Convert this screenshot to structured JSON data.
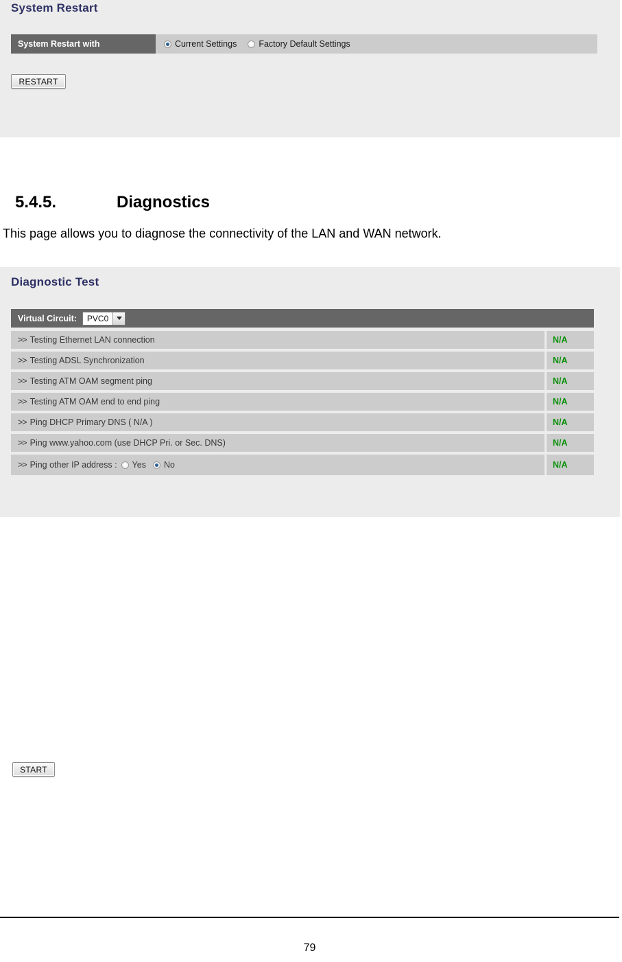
{
  "restart_panel": {
    "title": "System Restart",
    "label": "System Restart with",
    "options": [
      {
        "label": "Current Settings",
        "checked": true
      },
      {
        "label": "Factory Default Settings",
        "checked": false
      }
    ],
    "button_label": "RESTART"
  },
  "section": {
    "number": "5.4.5.",
    "heading": "Diagnostics",
    "intro": "This page allows you to diagnose the connectivity of the LAN and WAN network."
  },
  "diagnostic_panel": {
    "title": "Diagnostic Test",
    "virtual_circuit_label": "Virtual Circuit:",
    "virtual_circuit_value": "PVC0",
    "dropdown_icon": "chevron-down-icon",
    "rows": [
      {
        "prefix": ">>",
        "name": "Testing Ethernet LAN connection",
        "status": "N/A"
      },
      {
        "prefix": ">>",
        "name": "Testing ADSL Synchronization",
        "status": "N/A"
      },
      {
        "prefix": ">>",
        "name": "Testing ATM OAM segment ping",
        "status": "N/A"
      },
      {
        "prefix": ">>",
        "name": "Testing ATM OAM end to end ping",
        "status": "N/A"
      },
      {
        "prefix": ">>",
        "name": "Ping DHCP Primary DNS ( N/A )",
        "status": "N/A"
      },
      {
        "prefix": ">>",
        "name": "Ping www.yahoo.com (use DHCP Pri. or Sec. DNS)",
        "status": "N/A"
      },
      {
        "prefix": ">>",
        "name": "Ping other IP address :",
        "status": "N/A",
        "options": [
          {
            "label": "Yes",
            "checked": false
          },
          {
            "label": "No",
            "checked": true
          }
        ]
      }
    ],
    "button_label": "START"
  },
  "footer": {
    "page_number": "79"
  },
  "colors": {
    "panel_background": "#ececec",
    "label_cell": "#666666",
    "value_cell": "#cccccc",
    "title_text": "#2e3165",
    "status_green": "#089008",
    "radio_dot": "#2b5f93"
  }
}
